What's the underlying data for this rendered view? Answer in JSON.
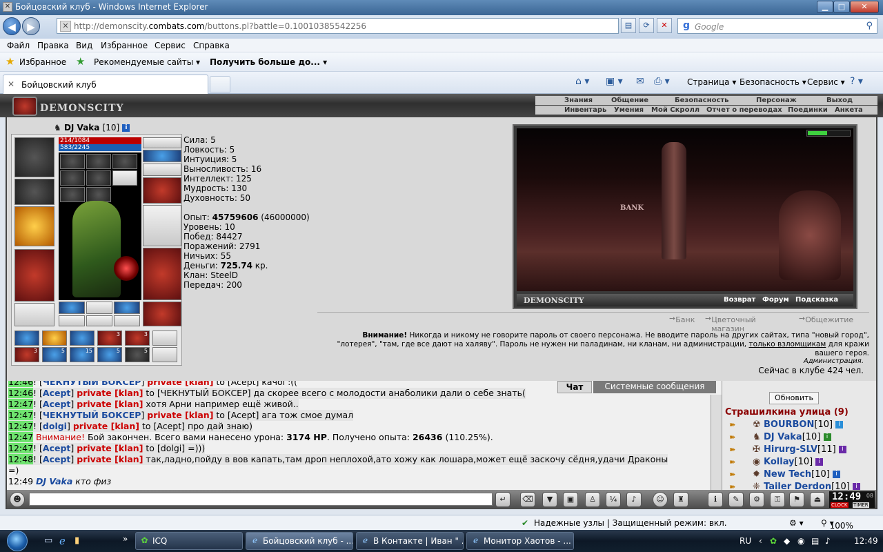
{
  "window": {
    "title": "Бойцовский клуб - Windows Internet Explorer",
    "minimize": "▁",
    "maximize": "□",
    "close": "✕"
  },
  "address": {
    "url_prefix": "http://demonscity.",
    "url_domain": "combats.com",
    "url_suffix": "/buttons.pl?battle=0.10010385542256",
    "search_placeholder": "Google"
  },
  "menu": [
    "Файл",
    "Правка",
    "Вид",
    "Избранное",
    "Сервис",
    "Справка"
  ],
  "favorites": {
    "favorites_label": "Избранное",
    "recommended_label": "Рекомендуемые сайты",
    "more_label": "Получить больше до..."
  },
  "tabs": {
    "active_label": "Бойцовский клуб",
    "tools": [
      "Страница",
      "Безопасность",
      "Сервис"
    ]
  },
  "game_header": {
    "logo_text": "DEMONSCITY",
    "nav_top": [
      "Знания",
      "Общение",
      "Безопасность",
      "Персонаж",
      "Выход"
    ],
    "nav_bottom": [
      "Инвентарь",
      "Умения",
      "Мой Скролл",
      "Отчет о переводах",
      "Поединки",
      "Анкета"
    ]
  },
  "character": {
    "name": "DJ Vaka",
    "level": "[10]",
    "hp": "214/1084",
    "mp": "583/2245",
    "slot_counts": [
      "3",
      "3",
      "3",
      "5",
      "15",
      "5",
      "5"
    ],
    "stats": [
      {
        "label": "Сила:",
        "value": "5"
      },
      {
        "label": "Ловкость:",
        "value": "5"
      },
      {
        "label": "Интуиция:",
        "value": "5"
      },
      {
        "label": "Выносливость:",
        "value": "16"
      },
      {
        "label": "Интеллект:",
        "value": "125"
      },
      {
        "label": "Мудрость:",
        "value": "130"
      },
      {
        "label": "Духовность:",
        "value": "50"
      }
    ],
    "exp_label": "Опыт:",
    "exp_value": "45759606",
    "exp_next": "(46000000)",
    "level_label": "Уровень:",
    "level_value": "10",
    "wins_label": "Побед:",
    "wins_value": "84427",
    "losses_label": "Поражений:",
    "losses_value": "2791",
    "draws_label": "Ничьих:",
    "draws_value": "55",
    "money_label": "Деньги:",
    "money_value": "725.74",
    "money_unit": "кр.",
    "clan_label": "Клан:",
    "clan_value": "SteelD",
    "transfers_label": "Передач:",
    "transfers_value": "200"
  },
  "gameview": {
    "bank_sign": "BANK",
    "logo": "DEMONSCITY",
    "links": [
      "Возврат",
      "Форум",
      "Подсказка"
    ],
    "sublinks": [
      "Банк",
      "Цветочный магазин",
      "Общежитие"
    ]
  },
  "warning": {
    "bold": "Внимание!",
    "text1": "Никогда и никому не говорите пароль от своего персонажа. Не вводите пароль на других сайтах, типа \"новый город\", \"лотерея\", \"там, где все дают на халяву\". Пароль не нужен ни паладинам, ни кланам, ни администрации,",
    "link": "только взломщикам",
    "text2": "для кражи вашего героя.",
    "admin": "Администрация.",
    "online": "Сейчас в клубе 424 чел."
  },
  "chat": {
    "tab_chat": "Чат",
    "tab_system": "Системные сообщения",
    "lines": [
      {
        "time": "12:46",
        "nick": "ЧЕКНУТЫЙ БОКСЕР",
        "priv": "private [klan]",
        "text": "to [Acept] качоi :(("
      },
      {
        "time": "12:46",
        "nick": "Acept",
        "priv": "private [klan]",
        "text": "to [ЧЕКНУТЫЙ БОКСЕР] да скорее всего с молодости анаболики дали о себе знать("
      },
      {
        "time": "12:47",
        "nick": "Acept",
        "priv": "private [klan]",
        "text": "хотя Арни например ещё живой.."
      },
      {
        "time": "12:47",
        "nick": "ЧЕКНУТЫЙ БОКСЕР",
        "priv": "private [klan]",
        "text": "to [Acept] ага тож смое думал"
      },
      {
        "time": "12:47",
        "nick": "dolgi",
        "priv": "private [klan]",
        "text": "to [Acept] про дай знаю)"
      },
      {
        "time": "12:47",
        "warn": "Внимание!",
        "text": "Бой закончен. Всего вами нанесено урона:",
        "dmg": "3174 HP",
        "text_b": ". Получено опыта:",
        "exp": "26436",
        "text_c": "(110.25%)."
      },
      {
        "time": "12:47",
        "nick": "Acept",
        "priv": "private [klan]",
        "text": "to [dolgi] =)))"
      },
      {
        "time": "12:48",
        "nick": "Acept",
        "priv": "private [klan]",
        "text": "так,ладно,пойду в вов капать,там дроп неплохой,ато хожу как лошара,может ещё заскочу сёдня,удачи Драконы"
      },
      {
        "text": "=)"
      },
      {
        "time": "12:49",
        "nick": "DJ Vaka",
        "text": "кто физ"
      }
    ]
  },
  "street": {
    "refresh": "Обновить",
    "title": "Страшилкина улица (9)",
    "users": [
      {
        "name": "BOURBON",
        "level": "[10]",
        "color": "#2b8fd8"
      },
      {
        "name": "DJ Vaka",
        "level": "[10]",
        "color": "#2a8a2a"
      },
      {
        "name": "Hirurg-SLV",
        "level": "[11]",
        "color": "#6a2aa8"
      },
      {
        "name": "Kollay",
        "level": "[10]",
        "color": "#6a2aa8"
      },
      {
        "name": "New Tech",
        "level": "[10]",
        "color": "#1f5fbf"
      },
      {
        "name": "Tailer Derdon",
        "level": "[10]",
        "color": "#6a2aa8"
      }
    ]
  },
  "clock": {
    "time": "12:49",
    "sec": "08",
    "label1": "CLOCK",
    "label2": "TIMER"
  },
  "statusbar": {
    "text": "Надежные узлы | Защищенный режим: вкл.",
    "zoom": "100%"
  },
  "taskbar": {
    "items": [
      "ICQ",
      "Бойцовский клуб - ...",
      "В Контакте | Иван \" ...",
      "Монитор Хаотов - ..."
    ],
    "lang": "RU",
    "time": "12:49"
  }
}
